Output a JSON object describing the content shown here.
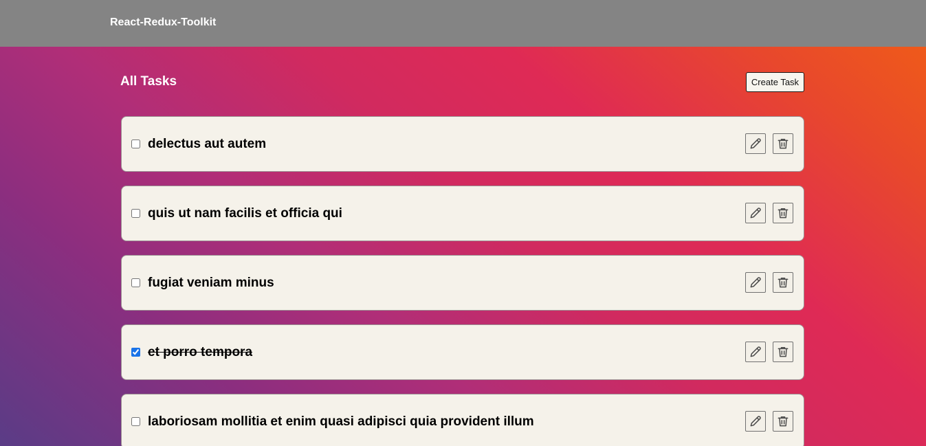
{
  "navbar": {
    "brand": "React-Redux-Toolkit"
  },
  "main": {
    "title": "All Tasks",
    "create_button_label": "Create Task"
  },
  "tasks": [
    {
      "title": "delectus aut autem",
      "completed": false
    },
    {
      "title": "quis ut nam facilis et officia qui",
      "completed": false
    },
    {
      "title": "fugiat veniam minus",
      "completed": false
    },
    {
      "title": "et porro tempora",
      "completed": true
    },
    {
      "title": "laboriosam mollitia et enim quasi adipisci quia provident illum",
      "completed": false
    }
  ],
  "icons": {
    "edit": "pencil-icon",
    "delete": "trash-icon"
  },
  "colors": {
    "navbar_bg": "#848484",
    "task_bg": "#f5f2ea",
    "checkbox_accent": "#1a73e8"
  }
}
